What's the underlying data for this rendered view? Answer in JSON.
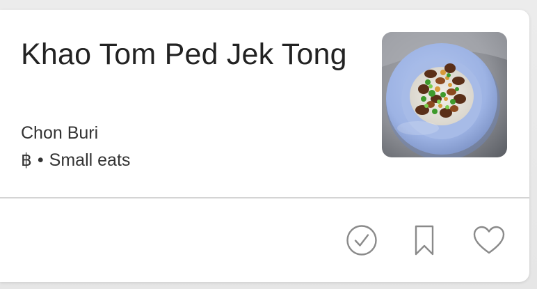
{
  "restaurant": {
    "name": "Khao Tom Ped Jek Tong",
    "location": "Chon Buri",
    "price": "฿",
    "separator": "•",
    "category": "Small eats"
  },
  "photo": {
    "subject": "bowl of rice with braised duck and herbs"
  },
  "actions": [
    {
      "icon": "checkmark-circle-icon"
    },
    {
      "icon": "bookmark-icon"
    },
    {
      "icon": "heart-icon"
    }
  ],
  "colors": {
    "text_primary": "#222222",
    "icon_gray": "#8a8a8a",
    "divider": "#d4d4d4",
    "bowl_blue": "#9eb6e8"
  }
}
